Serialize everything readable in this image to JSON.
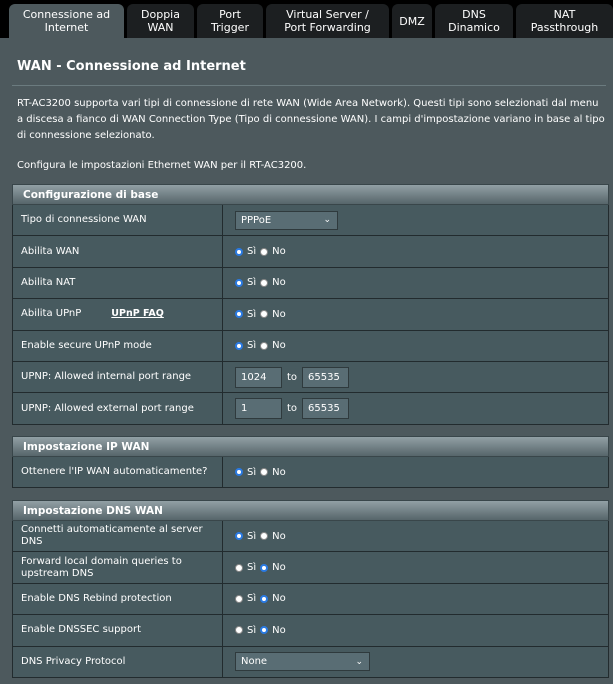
{
  "tabs": [
    {
      "label": "Connessione ad\nInternet",
      "active": true
    },
    {
      "label": "Doppia\nWAN",
      "active": false
    },
    {
      "label": "Port\nTrigger",
      "active": false
    },
    {
      "label": "Virtual Server /\nPort Forwarding",
      "active": false
    },
    {
      "label": "DMZ",
      "active": false
    },
    {
      "label": "DNS\nDinamico",
      "active": false
    },
    {
      "label": "NAT\nPassthrough",
      "active": false
    }
  ],
  "page": {
    "title": "WAN - Connessione ad Internet",
    "description": "RT-AC3200 supporta vari tipi di connessione di rete WAN (Wide Area Network). Questi tipi sono selezionati dal menu a discesa a fianco di WAN Connection Type (Tipo di connessione WAN). I campi d'impostazione variano in base al tipo di connessione selezionato.",
    "description2": "Configura le impostazioni Ethernet WAN per il RT-AC3200."
  },
  "radio": {
    "yes": "Sì",
    "no": "No"
  },
  "basic": {
    "header": "Configurazione di base",
    "wan_type_label": "Tipo di connessione WAN",
    "wan_type_value": "PPPoE",
    "enable_wan_label": "Abilita WAN",
    "enable_nat_label": "Abilita NAT",
    "enable_upnp_label": "Abilita UPnP",
    "upnp_faq_link": "UPnP FAQ",
    "secure_upnp_label": "Enable secure UPnP mode",
    "int_range_label": "UPNP: Allowed internal port range",
    "int_range_from": "1024",
    "int_range_to": "65535",
    "ext_range_label": "UPNP: Allowed external port range",
    "ext_range_from": "1",
    "ext_range_to": "65535",
    "to_text": "to"
  },
  "ipwan": {
    "header": "Impostazione IP WAN",
    "auto_ip_label": "Ottenere l'IP WAN automaticamente?"
  },
  "dnswan": {
    "header": "Impostazione DNS WAN",
    "auto_dns_label": "Connetti automaticamente al server DNS",
    "forward_label": "Forward local domain queries to upstream DNS",
    "rebind_label": "Enable DNS Rebind protection",
    "dnssec_label": "Enable DNSSEC support",
    "privacy_label": "DNS Privacy Protocol",
    "privacy_value": "None"
  },
  "colors": {
    "accent": "#2a7ae2",
    "panel": "#4d595d",
    "tab": "#1c1f21"
  }
}
